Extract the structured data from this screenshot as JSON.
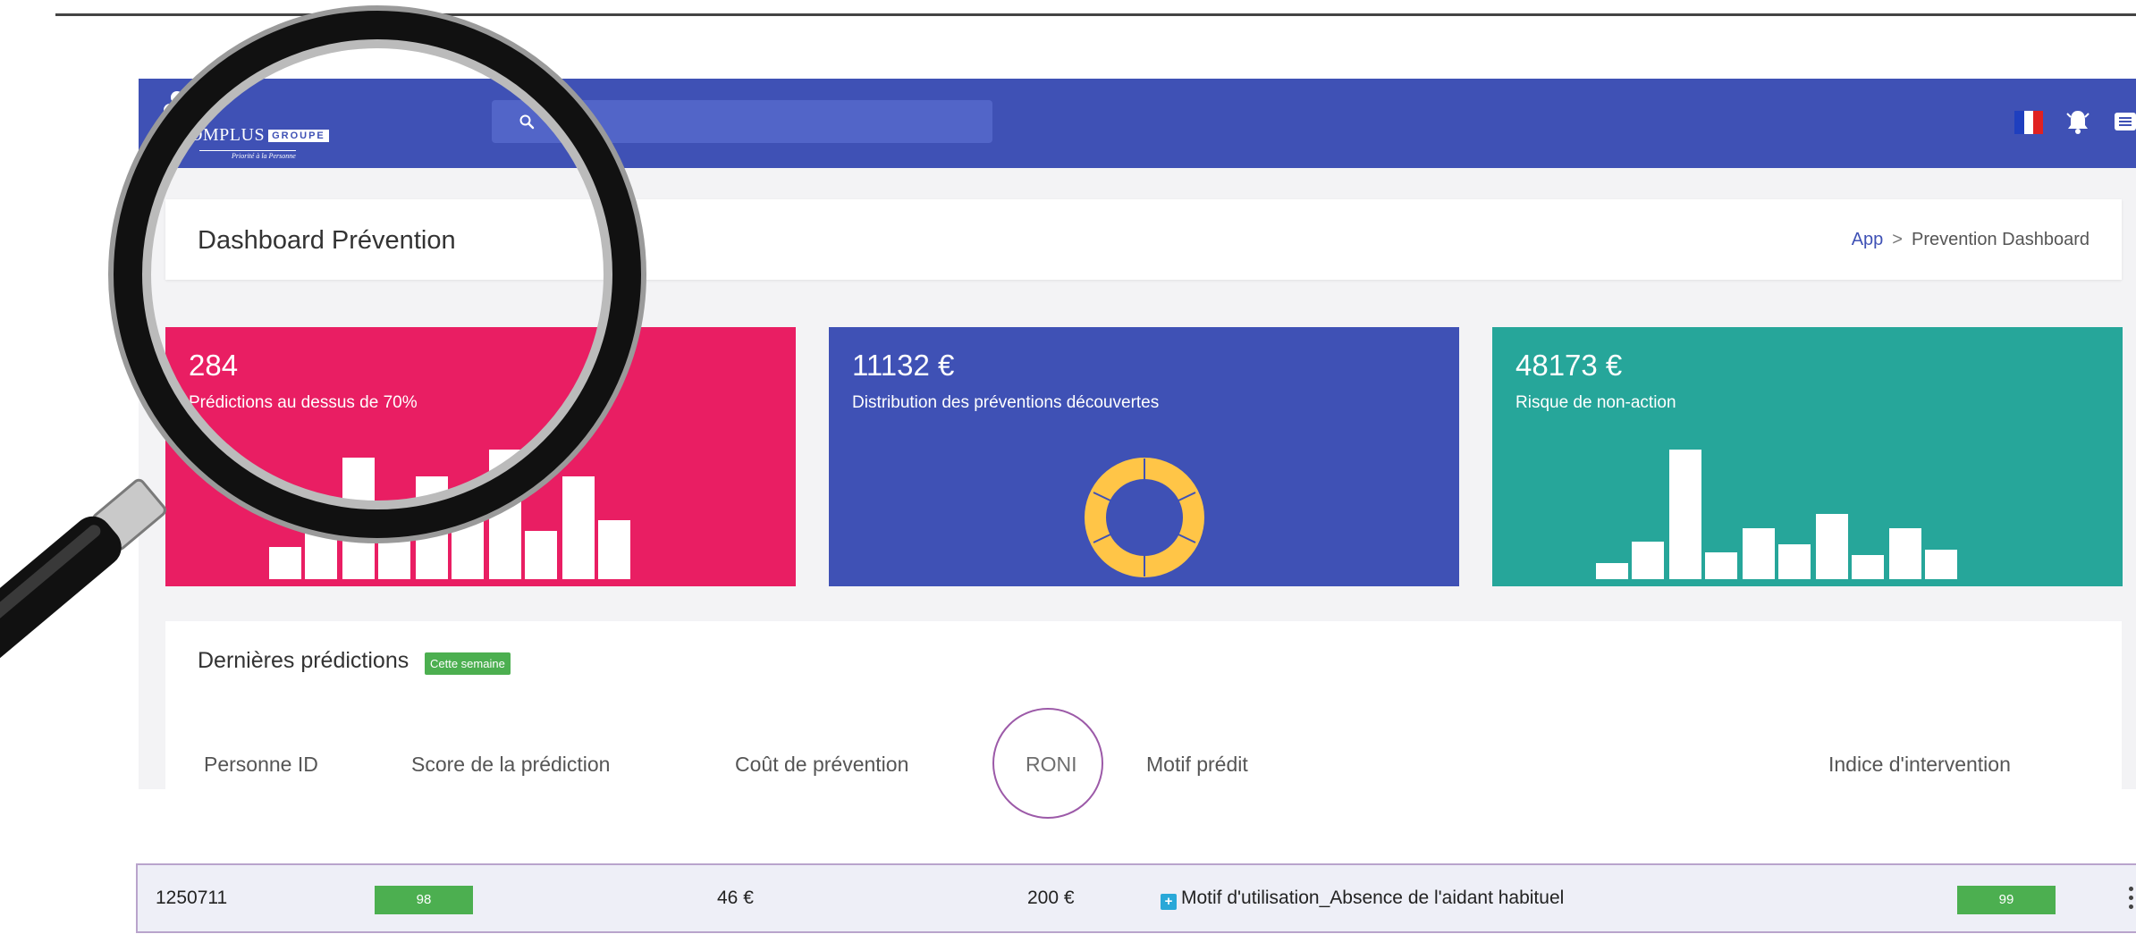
{
  "app": {
    "logo_text": "DOMPLUS",
    "logo_badge": "GROUPE",
    "logo_tagline": "Priorité à la Personne"
  },
  "navbar": {
    "search_placeholder": "",
    "search_icon": "search-icon",
    "flag_icon": "france-flag-icon",
    "bell_icon": "bell-icon",
    "menu_icon": "menu-icon",
    "color": "#3f51b5"
  },
  "header": {
    "title": "Dashboard Prévention",
    "breadcrumb": {
      "link": "App",
      "separator": ">",
      "current": "Prevention Dashboard"
    }
  },
  "stats": [
    {
      "value": "284",
      "label": "Prédictions au dessus de 70%",
      "color": "#e91e63",
      "chart": "bars",
      "bars": [
        12,
        28,
        45,
        20,
        38,
        26,
        48,
        18,
        38,
        22
      ]
    },
    {
      "value": "11132 €",
      "label": "Distribution des préventions découvertes",
      "color": "#3f51b5",
      "chart": "donut",
      "donut_color": "#ffc547"
    },
    {
      "value": "48173 €",
      "label": "Risque de non-action",
      "color": "#26a69a",
      "chart": "bars",
      "bars": [
        12,
        28,
        96,
        20,
        38,
        26,
        48,
        18,
        38,
        22
      ]
    }
  ],
  "predictions": {
    "title": "Dernières prédictions",
    "badge": "Cette semaine",
    "columns": [
      "Personne ID",
      "Score de la prédiction",
      "Coût de prévention",
      "RONI",
      "Motif prédit",
      "Indice d'intervention"
    ],
    "row": {
      "id": "1250711",
      "score": "98",
      "cost": "46 €",
      "roni": "200 €",
      "motif": "Motif d'utilisation_Absence de l'aidant habituel",
      "indice": "99"
    }
  },
  "colors": {
    "accent": "#3f51b5",
    "pink": "#e91e63",
    "teal": "#26a69a",
    "green": "#4caf50",
    "gold": "#ffc547"
  }
}
